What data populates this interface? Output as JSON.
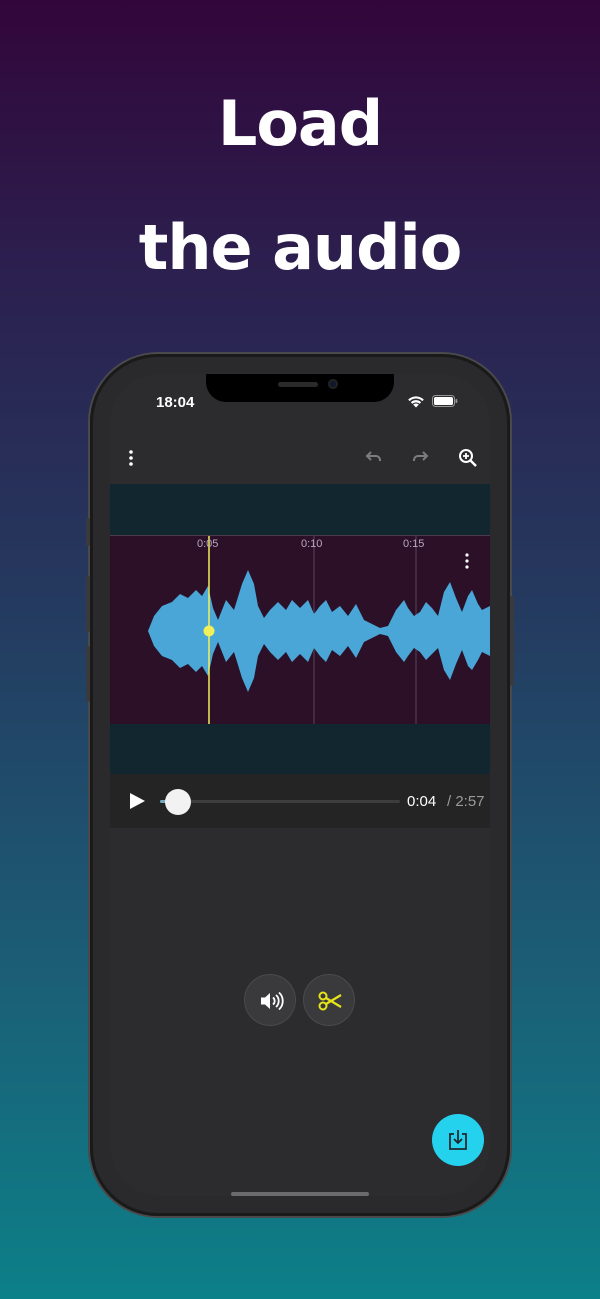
{
  "headline": {
    "line1": "Load",
    "line2": "the audio"
  },
  "status_bar": {
    "time": "18:04"
  },
  "toolbar": {
    "menu_icon": "more-vert-icon",
    "undo_icon": "undo-icon",
    "redo_icon": "redo-icon",
    "zoom_icon": "zoom-in-icon"
  },
  "timeline": {
    "ticks": [
      "0:05",
      "0:10",
      "0:15"
    ]
  },
  "player": {
    "current_time": "0:04",
    "total_time": "/ 2:57",
    "play_icon": "play-icon"
  },
  "actions": {
    "volume_icon": "volume-icon",
    "cut_icon": "scissors-icon",
    "export_icon": "download-tray-icon"
  },
  "colors": {
    "waveform": "#49a6d6",
    "playhead": "#f1f05a",
    "fab": "#25d2ee",
    "scissors": "#e8e41a"
  }
}
